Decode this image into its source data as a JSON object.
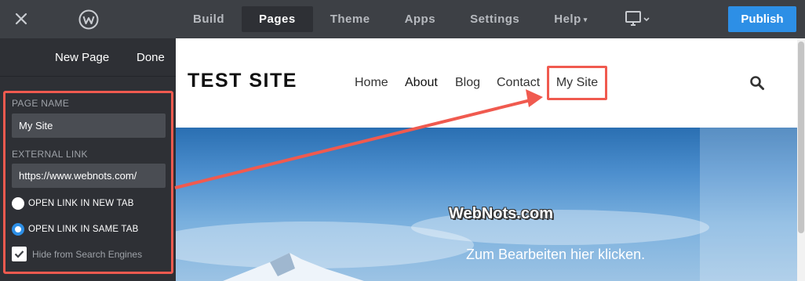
{
  "topbar": {
    "tabs": [
      {
        "label": "Build"
      },
      {
        "label": "Pages"
      },
      {
        "label": "Theme"
      },
      {
        "label": "Apps"
      },
      {
        "label": "Settings"
      },
      {
        "label": "Help"
      }
    ],
    "active_tab": "Pages",
    "publish_label": "Publish"
  },
  "sidebar": {
    "new_page_label": "New Page",
    "done_label": "Done",
    "page_name_label": "PAGE NAME",
    "page_name_value": "My Site",
    "external_link_label": "EXTERNAL LINK",
    "external_link_value": "https://www.webnots.com/",
    "open_new_tab_label": "OPEN LINK IN NEW TAB",
    "open_same_tab_label": "OPEN LINK IN SAME TAB",
    "selected_option": "OPEN LINK IN SAME TAB",
    "hide_search_label": "Hide from Search Engines",
    "hide_search_checked": true
  },
  "site": {
    "title": "TEST SITE",
    "nav": [
      {
        "label": "Home"
      },
      {
        "label": "About"
      },
      {
        "label": "Blog"
      },
      {
        "label": "Contact"
      },
      {
        "label": "My Site"
      }
    ],
    "watermark": "WebNots.com",
    "hero_text": "Zum Bearbeiten hier klicken."
  },
  "colors": {
    "topbar": "#3d4045",
    "sidebar": "#2e3035",
    "publish": "#2d8fe6",
    "highlight": "#f05a4f"
  }
}
